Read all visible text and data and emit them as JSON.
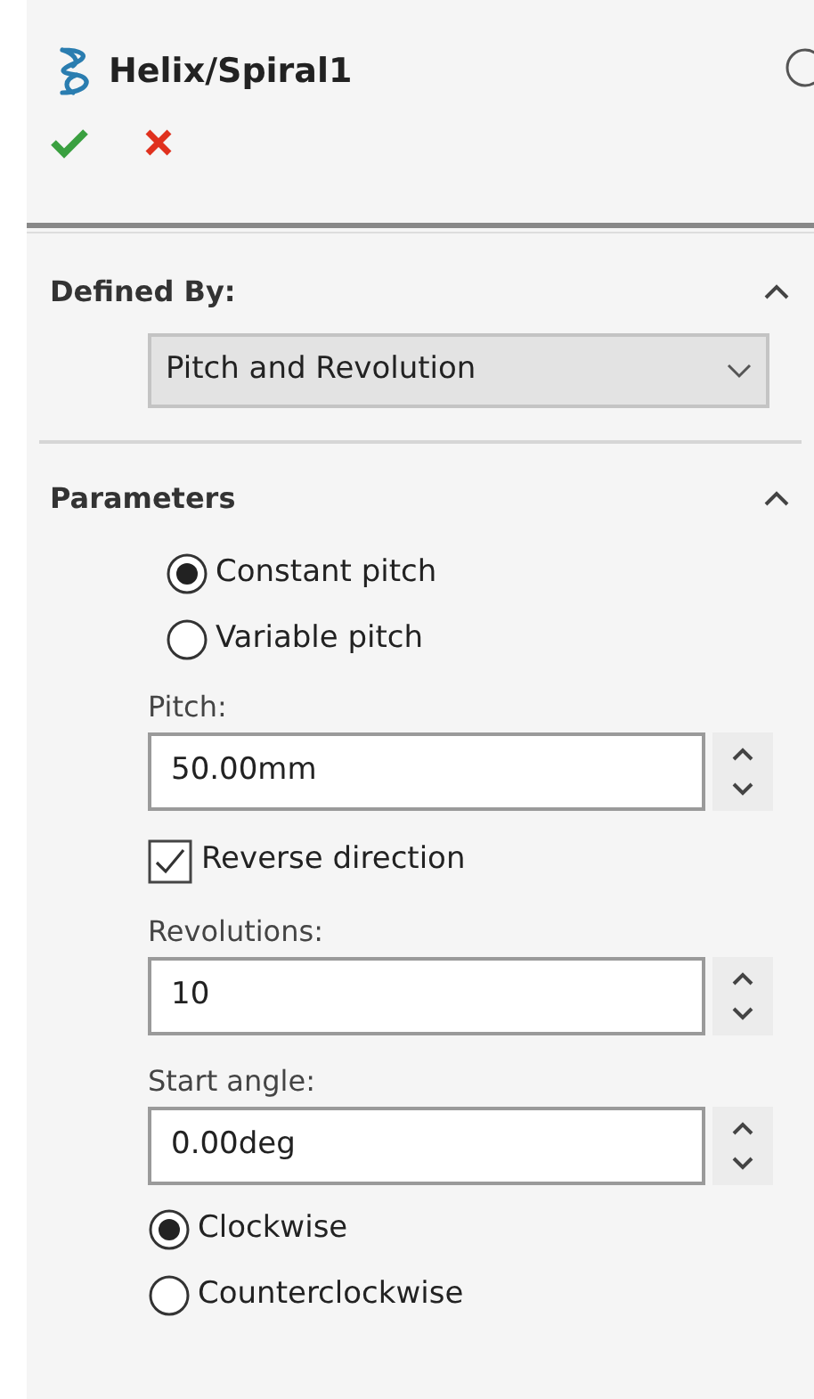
{
  "header": {
    "title": "Helix/Spiral1"
  },
  "sections": [
    {
      "title": "Defined By:",
      "expanded": true,
      "items": [
        {
          "kind": "dropdown",
          "value": "Pitch and Revolution"
        }
      ]
    },
    {
      "title": "Parameters",
      "expanded": true,
      "items": [
        {
          "kind": "option",
          "label": "Constant pitch",
          "selected": true
        },
        {
          "kind": "option",
          "label": "Variable pitch",
          "selected": false
        },
        {
          "kind": "spin",
          "label": "Pitch:",
          "value": "50.00mm"
        },
        {
          "kind": "checkbox",
          "label": "Reverse direction",
          "checked": true
        },
        {
          "kind": "spin",
          "label": "Revolutions:",
          "value": "10"
        },
        {
          "kind": "spin",
          "label": "Start angle:",
          "value": "0.00deg"
        },
        {
          "kind": "radio",
          "label": "Clockwise",
          "selected": true
        },
        {
          "kind": "radio",
          "label": "Counterclockwise",
          "selected": false
        }
      ]
    }
  ]
}
